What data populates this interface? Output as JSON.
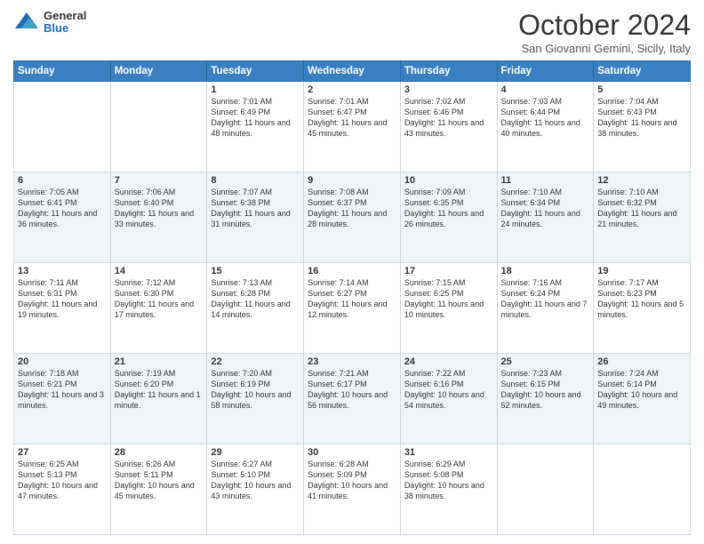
{
  "header": {
    "logo": {
      "general": "General",
      "blue": "Blue"
    },
    "title": "October 2024",
    "location": "San Giovanni Gemini, Sicily, Italy"
  },
  "weekdays": [
    "Sunday",
    "Monday",
    "Tuesday",
    "Wednesday",
    "Thursday",
    "Friday",
    "Saturday"
  ],
  "weeks": [
    [
      {
        "day": "",
        "info": ""
      },
      {
        "day": "",
        "info": ""
      },
      {
        "day": "1",
        "info": "Sunrise: 7:01 AM\nSunset: 6:49 PM\nDaylight: 11 hours and 48 minutes."
      },
      {
        "day": "2",
        "info": "Sunrise: 7:01 AM\nSunset: 6:47 PM\nDaylight: 11 hours and 45 minutes."
      },
      {
        "day": "3",
        "info": "Sunrise: 7:02 AM\nSunset: 6:46 PM\nDaylight: 11 hours and 43 minutes."
      },
      {
        "day": "4",
        "info": "Sunrise: 7:03 AM\nSunset: 6:44 PM\nDaylight: 11 hours and 40 minutes."
      },
      {
        "day": "5",
        "info": "Sunrise: 7:04 AM\nSunset: 6:43 PM\nDaylight: 11 hours and 38 minutes."
      }
    ],
    [
      {
        "day": "6",
        "info": "Sunrise: 7:05 AM\nSunset: 6:41 PM\nDaylight: 11 hours and 36 minutes."
      },
      {
        "day": "7",
        "info": "Sunrise: 7:06 AM\nSunset: 6:40 PM\nDaylight: 11 hours and 33 minutes."
      },
      {
        "day": "8",
        "info": "Sunrise: 7:07 AM\nSunset: 6:38 PM\nDaylight: 11 hours and 31 minutes."
      },
      {
        "day": "9",
        "info": "Sunrise: 7:08 AM\nSunset: 6:37 PM\nDaylight: 11 hours and 28 minutes."
      },
      {
        "day": "10",
        "info": "Sunrise: 7:09 AM\nSunset: 6:35 PM\nDaylight: 11 hours and 26 minutes."
      },
      {
        "day": "11",
        "info": "Sunrise: 7:10 AM\nSunset: 6:34 PM\nDaylight: 11 hours and 24 minutes."
      },
      {
        "day": "12",
        "info": "Sunrise: 7:10 AM\nSunset: 6:32 PM\nDaylight: 11 hours and 21 minutes."
      }
    ],
    [
      {
        "day": "13",
        "info": "Sunrise: 7:11 AM\nSunset: 6:31 PM\nDaylight: 11 hours and 19 minutes."
      },
      {
        "day": "14",
        "info": "Sunrise: 7:12 AM\nSunset: 6:30 PM\nDaylight: 11 hours and 17 minutes."
      },
      {
        "day": "15",
        "info": "Sunrise: 7:13 AM\nSunset: 6:28 PM\nDaylight: 11 hours and 14 minutes."
      },
      {
        "day": "16",
        "info": "Sunrise: 7:14 AM\nSunset: 6:27 PM\nDaylight: 11 hours and 12 minutes."
      },
      {
        "day": "17",
        "info": "Sunrise: 7:15 AM\nSunset: 6:25 PM\nDaylight: 11 hours and 10 minutes."
      },
      {
        "day": "18",
        "info": "Sunrise: 7:16 AM\nSunset: 6:24 PM\nDaylight: 11 hours and 7 minutes."
      },
      {
        "day": "19",
        "info": "Sunrise: 7:17 AM\nSunset: 6:23 PM\nDaylight: 11 hours and 5 minutes."
      }
    ],
    [
      {
        "day": "20",
        "info": "Sunrise: 7:18 AM\nSunset: 6:21 PM\nDaylight: 11 hours and 3 minutes."
      },
      {
        "day": "21",
        "info": "Sunrise: 7:19 AM\nSunset: 6:20 PM\nDaylight: 11 hours and 1 minute."
      },
      {
        "day": "22",
        "info": "Sunrise: 7:20 AM\nSunset: 6:19 PM\nDaylight: 10 hours and 58 minutes."
      },
      {
        "day": "23",
        "info": "Sunrise: 7:21 AM\nSunset: 6:17 PM\nDaylight: 10 hours and 56 minutes."
      },
      {
        "day": "24",
        "info": "Sunrise: 7:22 AM\nSunset: 6:16 PM\nDaylight: 10 hours and 54 minutes."
      },
      {
        "day": "25",
        "info": "Sunrise: 7:23 AM\nSunset: 6:15 PM\nDaylight: 10 hours and 52 minutes."
      },
      {
        "day": "26",
        "info": "Sunrise: 7:24 AM\nSunset: 6:14 PM\nDaylight: 10 hours and 49 minutes."
      }
    ],
    [
      {
        "day": "27",
        "info": "Sunrise: 6:25 AM\nSunset: 5:13 PM\nDaylight: 10 hours and 47 minutes."
      },
      {
        "day": "28",
        "info": "Sunrise: 6:26 AM\nSunset: 5:11 PM\nDaylight: 10 hours and 45 minutes."
      },
      {
        "day": "29",
        "info": "Sunrise: 6:27 AM\nSunset: 5:10 PM\nDaylight: 10 hours and 43 minutes."
      },
      {
        "day": "30",
        "info": "Sunrise: 6:28 AM\nSunset: 5:09 PM\nDaylight: 10 hours and 41 minutes."
      },
      {
        "day": "31",
        "info": "Sunrise: 6:29 AM\nSunset: 5:08 PM\nDaylight: 10 hours and 38 minutes."
      },
      {
        "day": "",
        "info": ""
      },
      {
        "day": "",
        "info": ""
      }
    ]
  ]
}
